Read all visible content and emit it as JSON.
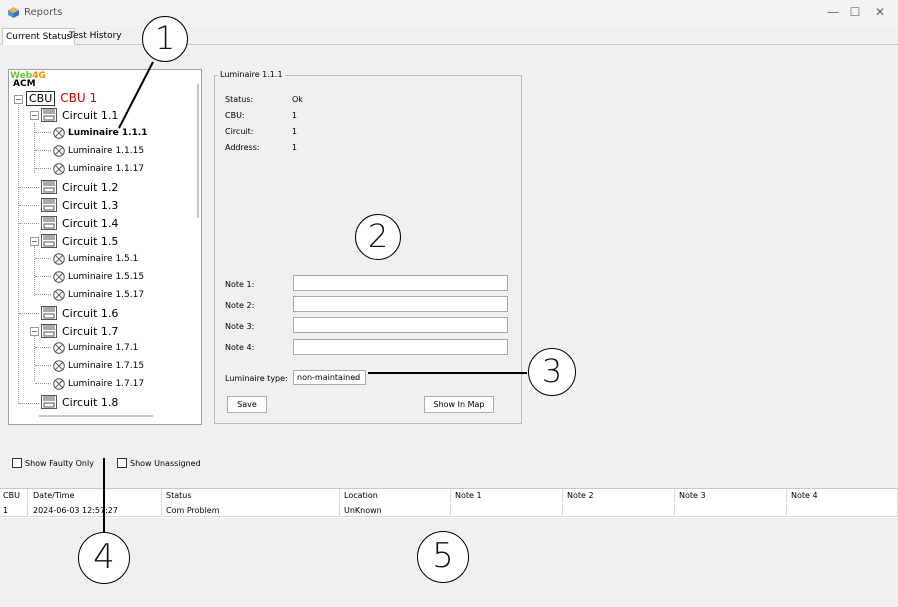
{
  "window": {
    "title": "Reports",
    "minimize": "—",
    "maximize": "☐",
    "close": "✕"
  },
  "tabs": [
    {
      "label": "Current Status",
      "active": true
    },
    {
      "label": "Test History",
      "active": false
    }
  ],
  "tree": {
    "logo_web": "Web",
    "logo_4g": "4G",
    "logo_acm": "ACM",
    "cbu_box": "CBU",
    "cbu_label": "CBU 1",
    "items": [
      {
        "label": "Circuit 1.1"
      },
      {
        "label": "Luminaire 1.1.1",
        "selected": true
      },
      {
        "label": "Luminaire 1.1.15"
      },
      {
        "label": "Luminaire 1.1.17"
      },
      {
        "label": "Circuit 1.2"
      },
      {
        "label": "Circuit 1.3"
      },
      {
        "label": "Circuit 1.4"
      },
      {
        "label": "Circuit 1.5"
      },
      {
        "label": "Luminaire 1.5.1"
      },
      {
        "label": "Luminaire 1.5.15"
      },
      {
        "label": "Luminaire 1.5.17"
      },
      {
        "label": "Circuit 1.6"
      },
      {
        "label": "Circuit 1.7"
      },
      {
        "label": "Luminaire 1.7.1"
      },
      {
        "label": "Luminaire 1.7.15"
      },
      {
        "label": "Luminaire 1.7.17"
      },
      {
        "label": "Circuit 1.8"
      }
    ]
  },
  "details": {
    "title": "Luminaire 1.1.1",
    "fields": [
      {
        "label": "Status:",
        "value": "Ok"
      },
      {
        "label": "CBU:",
        "value": "1"
      },
      {
        "label": "Circuit:",
        "value": "1"
      },
      {
        "label": "Address:",
        "value": "1"
      }
    ],
    "notes": [
      {
        "label": "Note 1:",
        "value": ""
      },
      {
        "label": "Note 2:",
        "value": ""
      },
      {
        "label": "Note 3:",
        "value": ""
      },
      {
        "label": "Note 4:",
        "value": ""
      }
    ],
    "luminaire_type_label": "Luminaire type:",
    "luminaire_type_value": "non-maintained",
    "save_label": "Save",
    "show_in_map_label": "Show In Map"
  },
  "filters": {
    "show_faulty_only": "Show Faulty Only",
    "show_unassigned": "Show Unassigned"
  },
  "table": {
    "headers": [
      "CBU",
      "Date/Time",
      "Status",
      "Location",
      "Note 1",
      "Note 2",
      "Note 3",
      "Note 4"
    ],
    "rows": [
      [
        "1",
        "2024-06-03 12:57:27",
        "Com Problem",
        "UnKnown",
        "",
        "",
        "",
        ""
      ]
    ]
  },
  "annotations": [
    "1",
    "2",
    "3",
    "4",
    "5"
  ],
  "colors": {
    "cbu_label": "#d00000",
    "logo_green": "#66cc33",
    "logo_orange": "#ff8c00"
  }
}
